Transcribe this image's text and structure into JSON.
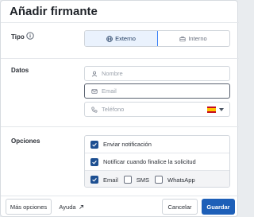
{
  "dialog": {
    "title": "Añadir firmante"
  },
  "tipo": {
    "label": "Tipo",
    "info_icon": "info-icon",
    "options": [
      {
        "label": "Externo",
        "icon": "globe-icon",
        "selected": true
      },
      {
        "label": "Interno",
        "icon": "briefcase-icon",
        "selected": false
      }
    ]
  },
  "datos": {
    "label": "Datos",
    "nombre": {
      "placeholder": "Nombre",
      "icon": "user-icon",
      "value": ""
    },
    "email": {
      "placeholder": "Email",
      "icon": "mail-icon",
      "value": ""
    },
    "telefono": {
      "placeholder": "Teléfono",
      "icon": "phone-icon",
      "value": "",
      "country_flag": "flag-es-icon"
    }
  },
  "opciones": {
    "label": "Opciones",
    "enviar_notificacion": {
      "label": "Enviar notificación",
      "checked": true
    },
    "notificar_finalice": {
      "label": "Notificar cuando finalice la solicitud",
      "checked": true
    },
    "channels": [
      {
        "label": "Email",
        "checked": true
      },
      {
        "label": "SMS",
        "checked": false
      },
      {
        "label": "WhatsApp",
        "checked": false
      }
    ]
  },
  "footer": {
    "mas_opciones": "Más opciones",
    "ayuda": "Ayuda",
    "cancelar": "Cancelar",
    "guardar": "Guardar"
  },
  "colors": {
    "primary": "#1d5fb8",
    "checkbox_on": "#1d4f91",
    "selected_segment_bg": "#eaf2fd",
    "selected_segment_border": "#3b82f6"
  }
}
